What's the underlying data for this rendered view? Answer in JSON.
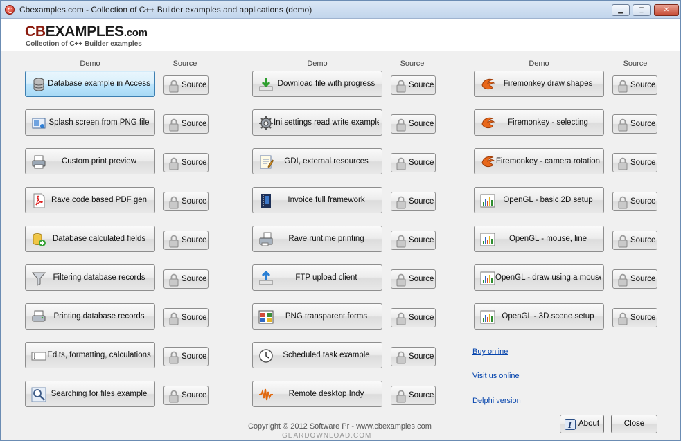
{
  "window": {
    "title": "Cbexamples.com - Collection of C++ Builder examples and applications (demo)",
    "controls": {
      "minimize": "▁",
      "maximize": "▢",
      "close": "✕"
    }
  },
  "header": {
    "logo_cb": "CB",
    "logo_examples": "EXAMPLES",
    "logo_domain": ".com",
    "subtitle": "Collection of C++ Builder examples"
  },
  "column_headers": {
    "demo": "Demo",
    "source": "Source"
  },
  "source_label": "Source",
  "columns": [
    {
      "items": [
        {
          "label": "Database example in Access",
          "icon": "database-icon",
          "focused": true
        },
        {
          "label": "Splash screen from PNG file",
          "icon": "splash-screen-icon"
        },
        {
          "label": "Custom print preview",
          "icon": "printer-icon"
        },
        {
          "label": "Rave code based PDF gen",
          "icon": "pdf-icon"
        },
        {
          "label": "Database calculated fields",
          "icon": "database-add-icon"
        },
        {
          "label": "Filtering database records",
          "icon": "filter-icon"
        },
        {
          "label": "Printing database records",
          "icon": "print-records-icon"
        },
        {
          "label": "Edits, formatting, calculations",
          "icon": "edit-field-icon"
        },
        {
          "label": "Searching for files example",
          "icon": "search-icon"
        }
      ]
    },
    {
      "items": [
        {
          "label": "Download file with progress",
          "icon": "download-icon"
        },
        {
          "label": "Ini settings read write example",
          "icon": "gear-icon"
        },
        {
          "label": "GDI, external resources",
          "icon": "notepad-icon"
        },
        {
          "label": "Invoice full framework",
          "icon": "film-icon"
        },
        {
          "label": "Rave runtime printing",
          "icon": "runtime-printer-icon"
        },
        {
          "label": "FTP upload client",
          "icon": "upload-icon"
        },
        {
          "label": "PNG transparent forms",
          "icon": "forms-icon"
        },
        {
          "label": "Scheduled task example",
          "icon": "clock-icon"
        },
        {
          "label": "Remote desktop Indy",
          "icon": "waveform-icon"
        }
      ]
    },
    {
      "items": [
        {
          "label": "Firemonkey draw shapes",
          "icon": "firemonkey-icon"
        },
        {
          "label": "Firemonkey - selecting",
          "icon": "firemonkey-icon"
        },
        {
          "label": "Firemonkey - camera rotation",
          "icon": "firemonkey-icon"
        },
        {
          "label": "OpenGL - basic 2D setup",
          "icon": "opengl-chart-icon"
        },
        {
          "label": "OpenGL - mouse, line",
          "icon": "opengl-chart-icon"
        },
        {
          "label": "OpenGL - draw using a mouse",
          "icon": "opengl-chart-icon"
        },
        {
          "label": "OpenGL - 3D scene setup",
          "icon": "opengl-chart-icon"
        }
      ]
    }
  ],
  "links": {
    "buy_online": "Buy online",
    "visit_us_online": "Visit us online",
    "delphi_version": "Delphi version"
  },
  "footer": {
    "copyright": "Copyright © 2012 Software Pr - www.cbexamples.com",
    "about": "About",
    "close": "Close",
    "watermark": "GEARDOWNLOAD.COM"
  },
  "colors": {
    "brand_red": "#8b1c0f",
    "link": "#0645ad",
    "focus": "#3c7fb1"
  }
}
